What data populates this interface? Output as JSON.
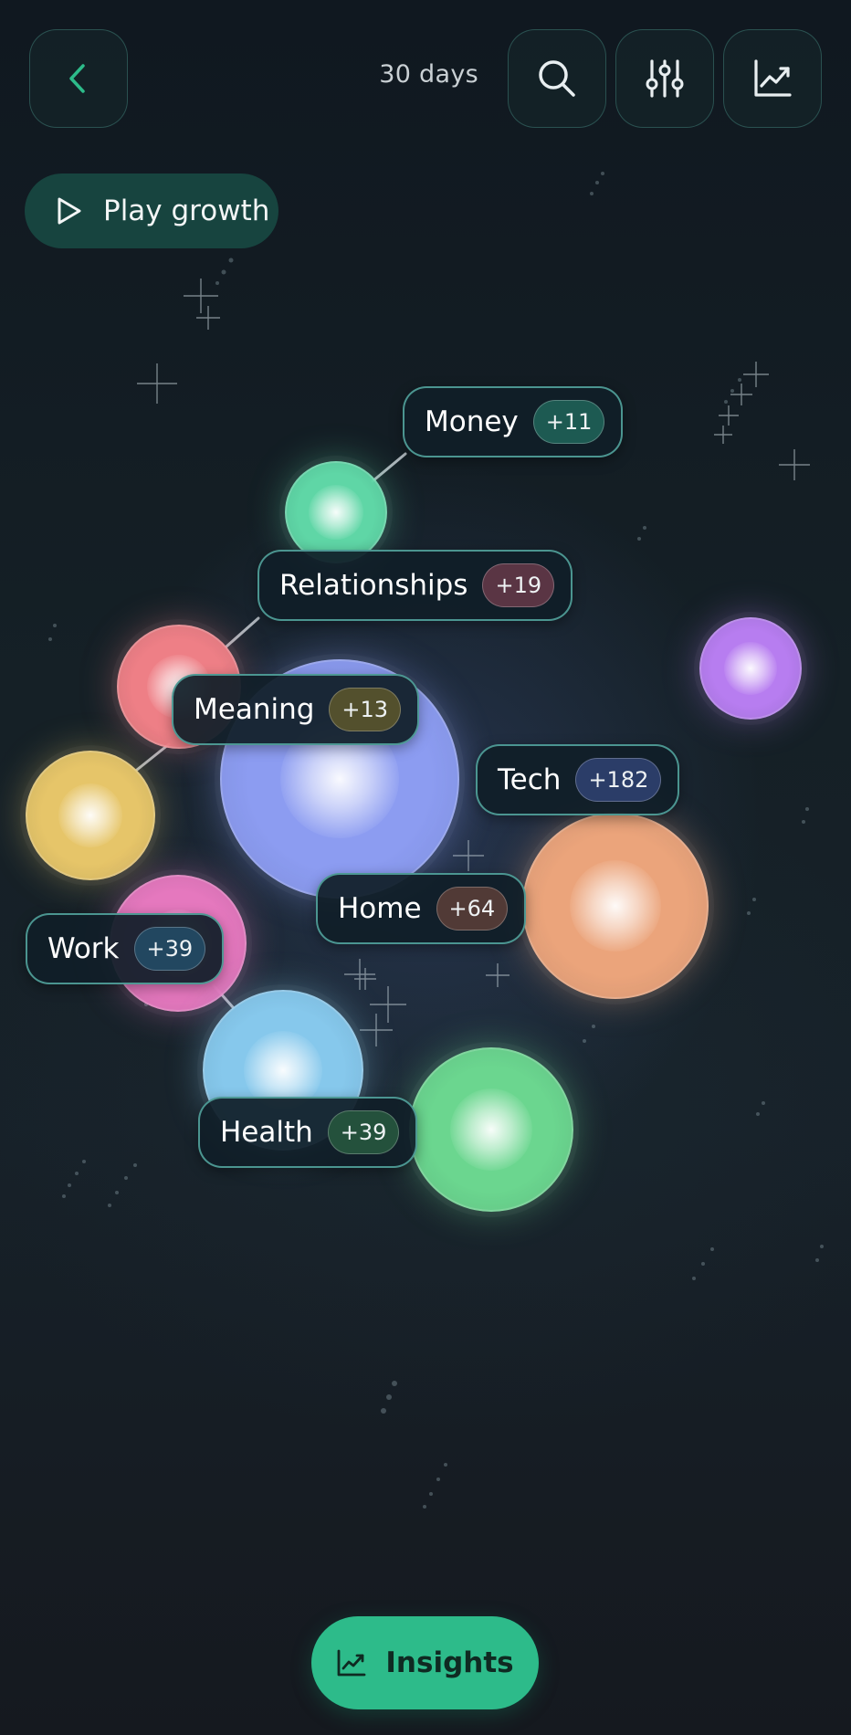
{
  "header": {
    "period_label": "30 days",
    "icons": {
      "back": "chevron-left-icon",
      "search": "search-icon",
      "filter": "sliders-icon",
      "trend": "trend-chart-icon"
    },
    "accent_color": "#2dbb8a"
  },
  "play_growth": {
    "label": "Play growth",
    "icon": "play-icon"
  },
  "bubbles": [
    {
      "id": "money",
      "color": "#5fd6a6"
    },
    {
      "id": "relationships",
      "color": "#ee7f86"
    },
    {
      "id": "meaning",
      "color": "#8c9cf1"
    },
    {
      "id": "yellow",
      "color": "#e6c569"
    },
    {
      "id": "tech",
      "color": "#b77df0"
    },
    {
      "id": "home",
      "color": "#eba47b"
    },
    {
      "id": "work",
      "color": "#e578be"
    },
    {
      "id": "health-blue",
      "color": "#86c8ec"
    },
    {
      "id": "health",
      "color": "#6bd68f"
    }
  ],
  "labels": [
    {
      "name": "Money",
      "delta": "+11",
      "pill_color": "#1d5a52"
    },
    {
      "name": "Relationships",
      "delta": "+19",
      "pill_color": "#5a3544"
    },
    {
      "name": "Meaning",
      "delta": "+13",
      "pill_color": "#53502d"
    },
    {
      "name": "Tech",
      "delta": "+182",
      "pill_color": "#2b3d68"
    },
    {
      "name": "Home",
      "delta": "+64",
      "pill_color": "#513a36"
    },
    {
      "name": "Work",
      "delta": "+39",
      "pill_color": "#224760"
    },
    {
      "name": "Health",
      "delta": "+39",
      "pill_color": "#24513c"
    }
  ],
  "insights": {
    "label": "Insights",
    "icon": "trend-chart-icon"
  }
}
